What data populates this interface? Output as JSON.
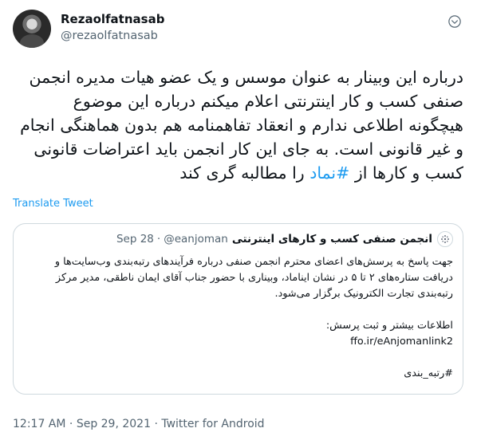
{
  "author": {
    "display_name": "Rezaolfatnasab",
    "handle": "@rezaolfatnasab"
  },
  "tweet": {
    "text_before_hashtag": "درباره این وبینار به عنوان موسس و یک عضو هیات مدیره انجمن صنفی کسب و کار اینترنتی اعلام میکنم درباره این موضوع هیچگونه اطلاعی ندارم و انعقاد تفاهمنامه هم بدون هماهنگی انجام و غیر قانونی است. به جای این کار انجمن باید اعتراضات قانونی کسب و کارها از ",
    "hashtag": "#نماد",
    "text_after_hashtag": " را مطالبه گری کند"
  },
  "translate_label": "Translate Tweet",
  "quoted": {
    "name": "انجمن صنفی کسب و کارهای اینترنتی",
    "handle": "@eanjoman",
    "separator": "·",
    "date": "Sep 28",
    "paragraph": "جهت پاسخ به پرسش‌های اعضای محترم انجمن صنفی درباره فرآیندهای رتبه‌بندی وب‌سایت‌ها و دریافت ستاره‌های ۲ تا ۵ در نشان ایناماد، وبیناری با حضور جناب آقای ایمان ناطقی، مدیر مرکز رتبه‌بندی تجارت الکترونیک برگزار می‌شود.",
    "info_line": "اطلاعات بیشتر و ثبت پرسش:",
    "link": "ffo.ir/eAnjomanlink2",
    "hashtag": "#رتبه_بندی"
  },
  "footer": {
    "time": "12:17 AM",
    "separator": "·",
    "date": "Sep 29, 2021",
    "separator2": "·",
    "source": "Twitter for Android"
  },
  "icons": {
    "more": "more-icon",
    "quoted_avatar": "association-logo-icon"
  },
  "colors": {
    "link": "#1d9bf0",
    "secondary_text": "#536471",
    "border": "#cfd9de"
  }
}
